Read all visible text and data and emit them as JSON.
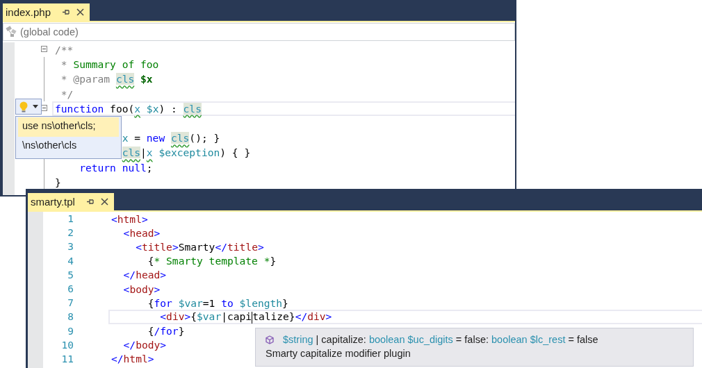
{
  "windows": [
    {
      "tab": {
        "label": "index.php",
        "selected": true
      },
      "navigation_bar": {
        "scope": "(global code)"
      },
      "lines": [
        {
          "fold": true,
          "current": false,
          "tokens": [
            {
              "text": "/**",
              "kind": "doc"
            }
          ]
        },
        {
          "fold": false,
          "current": false,
          "tokens": [
            {
              "text": " * ",
              "kind": "doc"
            },
            {
              "text": "Summary of foo",
              "kind": "comment"
            }
          ]
        },
        {
          "fold": false,
          "current": false,
          "tokens": [
            {
              "text": " * @param ",
              "kind": "doc"
            },
            {
              "text": "cls",
              "kind": "type"
            },
            {
              "text": " $x",
              "kind": "docvar"
            }
          ]
        },
        {
          "fold": false,
          "current": false,
          "tokens": [
            {
              "text": " */",
              "kind": "doc"
            }
          ]
        },
        {
          "fold": true,
          "current": true,
          "tokens": [
            {
              "text": "function",
              "kind": "keyword"
            },
            {
              "text": " foo(",
              "kind": "text"
            },
            {
              "text": "x",
              "kind": "typeref"
            },
            {
              "text": " $x",
              "kind": "var"
            },
            {
              "text": ") : ",
              "kind": "text"
            },
            {
              "text": "cls",
              "kind": "type"
            }
          ]
        },
        {
          "fold": false,
          "current": false
        },
        {
          "fold": false,
          "current": false,
          "tokens": [
            {
              "text": "           x",
              "kind": "var"
            },
            {
              "text": " = ",
              "kind": "text"
            },
            {
              "text": "new ",
              "kind": "keyword"
            },
            {
              "text": "cls",
              "kind": "type"
            },
            {
              "text": "(); }",
              "kind": "text"
            }
          ]
        },
        {
          "fold": false,
          "current": false,
          "tokens": [
            {
              "text": "           cls",
              "kind": "type"
            },
            {
              "text": "|",
              "kind": "text"
            },
            {
              "text": "x",
              "kind": "typeref"
            },
            {
              "text": " $exception",
              "kind": "var"
            },
            {
              "text": ") { }",
              "kind": "text"
            }
          ]
        },
        {
          "fold": false,
          "current": false,
          "tokens": [
            {
              "text": "    return null",
              "kind": "keyword"
            },
            {
              "text": ";",
              "kind": "text"
            }
          ]
        },
        {
          "fold": false,
          "current": false,
          "tokens": [
            {
              "text": "}",
              "kind": "text"
            }
          ]
        }
      ],
      "lightbulb": {
        "expanded": true,
        "items": [
          {
            "label": "use ns\\other\\cls;",
            "selected": true
          },
          {
            "label": "\\ns\\other\\cls",
            "selected": false
          }
        ]
      }
    },
    {
      "tab": {
        "label": "smarty.tpl",
        "selected": true
      },
      "lines": [
        {
          "number": "1",
          "current": false,
          "tokens": [
            {
              "text": "<",
              "kind": "punct"
            },
            {
              "text": "html",
              "kind": "tag"
            },
            {
              "text": ">",
              "kind": "punct"
            }
          ]
        },
        {
          "number": "2",
          "current": false,
          "tokens": [
            {
              "text": "  <",
              "kind": "punct"
            },
            {
              "text": "head",
              "kind": "tag"
            },
            {
              "text": ">",
              "kind": "punct"
            }
          ]
        },
        {
          "number": "3",
          "current": false,
          "tokens": [
            {
              "text": "    <",
              "kind": "punct"
            },
            {
              "text": "title",
              "kind": "tag"
            },
            {
              "text": ">",
              "kind": "punct"
            },
            {
              "text": "Smarty",
              "kind": "text"
            },
            {
              "text": "</",
              "kind": "punct"
            },
            {
              "text": "title",
              "kind": "tag"
            },
            {
              "text": ">",
              "kind": "punct"
            }
          ]
        },
        {
          "number": "4",
          "current": false,
          "tokens": [
            {
              "text": "      {",
              "kind": "text"
            },
            {
              "text": "* Smarty template *",
              "kind": "comment"
            },
            {
              "text": "}",
              "kind": "text"
            }
          ]
        },
        {
          "number": "5",
          "current": false,
          "tokens": [
            {
              "text": "  </",
              "kind": "punct"
            },
            {
              "text": "head",
              "kind": "tag"
            },
            {
              "text": ">",
              "kind": "punct"
            }
          ]
        },
        {
          "number": "6",
          "current": false,
          "tokens": [
            {
              "text": "  <",
              "kind": "punct"
            },
            {
              "text": "body",
              "kind": "tag"
            },
            {
              "text": ">",
              "kind": "punct"
            }
          ]
        },
        {
          "number": "7",
          "current": false,
          "tokens": [
            {
              "text": "      {",
              "kind": "text"
            },
            {
              "text": "for",
              "kind": "keyword"
            },
            {
              "text": " $var",
              "kind": "var"
            },
            {
              "text": "=1 ",
              "kind": "text"
            },
            {
              "text": "to",
              "kind": "keyword"
            },
            {
              "text": " $length",
              "kind": "var"
            },
            {
              "text": "}",
              "kind": "text"
            }
          ]
        },
        {
          "number": "8",
          "current": true,
          "tokens": [
            {
              "text": "        <",
              "kind": "punct"
            },
            {
              "text": "div",
              "kind": "tag"
            },
            {
              "text": ">",
              "kind": "punct"
            },
            {
              "text": "{",
              "kind": "text"
            },
            {
              "text": "$var",
              "kind": "var"
            },
            {
              "text": "|capi",
              "kind": "text",
              "caret": true
            },
            {
              "text": "talize}",
              "kind": "text"
            },
            {
              "text": "</",
              "kind": "punct"
            },
            {
              "text": "div",
              "kind": "tag"
            },
            {
              "text": ">",
              "kind": "punct"
            }
          ]
        },
        {
          "number": "9",
          "current": false,
          "tokens": [
            {
              "text": "      {",
              "kind": "text"
            },
            {
              "text": "/for",
              "kind": "keyword"
            },
            {
              "text": "}",
              "kind": "text"
            }
          ]
        },
        {
          "number": "10",
          "current": false,
          "tokens": [
            {
              "text": "  </",
              "kind": "punct"
            },
            {
              "text": "body",
              "kind": "tag"
            },
            {
              "text": ">",
              "kind": "punct"
            }
          ]
        },
        {
          "number": "11",
          "current": false,
          "tokens": [
            {
              "text": "</",
              "kind": "punct"
            },
            {
              "text": "html",
              "kind": "tag"
            },
            {
              "text": ">",
              "kind": "punct"
            }
          ]
        }
      ],
      "tooltip": {
        "signature": [
          {
            "text": "$string",
            "kind": "param"
          },
          {
            "text": " | capitalize: ",
            "kind": "plain"
          },
          {
            "text": "boolean $uc_digits",
            "kind": "param"
          },
          {
            "text": " = false: ",
            "kind": "plain"
          },
          {
            "text": "boolean $lc_rest",
            "kind": "param"
          },
          {
            "text": " = false",
            "kind": "plain"
          }
        ],
        "description": "Smarty capitalize modifier plugin"
      }
    }
  ]
}
